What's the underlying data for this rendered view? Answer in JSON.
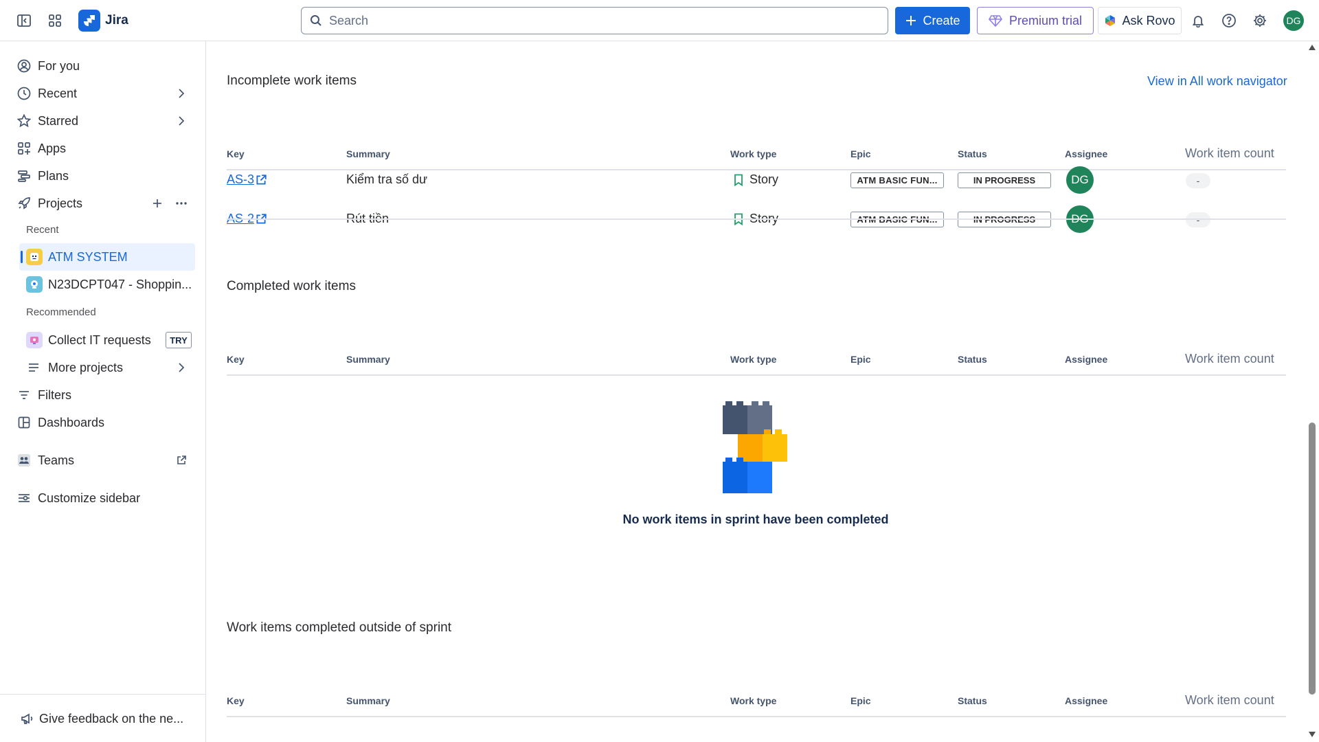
{
  "app": {
    "name": "Jira"
  },
  "search": {
    "placeholder": "Search"
  },
  "topbar": {
    "create_label": "Create",
    "premium_label": "Premium trial",
    "rovo_label": "Ask Rovo",
    "user_initials": "DG"
  },
  "sidebar": {
    "items": [
      {
        "label": "For you"
      },
      {
        "label": "Recent"
      },
      {
        "label": "Starred"
      },
      {
        "label": "Apps"
      },
      {
        "label": "Plans"
      },
      {
        "label": "Projects"
      }
    ],
    "recent_heading": "Recent",
    "recent_projects": [
      {
        "label": "ATM SYSTEM"
      },
      {
        "label": "N23DCPT047 - Shoppin..."
      }
    ],
    "recommended_heading": "Recommended",
    "recommended": [
      {
        "label": "Collect IT requests",
        "badge": "TRY"
      }
    ],
    "more_projects": "More projects",
    "filters": "Filters",
    "dashboards": "Dashboards",
    "teams": "Teams",
    "customize": "Customize sidebar",
    "feedback": "Give feedback on the ne..."
  },
  "columns": {
    "key": "Key",
    "summary": "Summary",
    "work_type": "Work type",
    "epic": "Epic",
    "status": "Status",
    "assignee": "Assignee",
    "count": "Work item count"
  },
  "incomplete": {
    "title": "Incomplete work items",
    "view_link": "View in All work navigator",
    "rows": [
      {
        "key": "AS-3",
        "summary": "Kiểm tra số dư",
        "work_type": "Story",
        "epic": "ATM BASIC FUN...",
        "status": "IN PROGRESS",
        "assignee": "DG",
        "count": "-"
      },
      {
        "key": "AS-2",
        "summary": "Rút tiền",
        "work_type": "Story",
        "epic": "ATM BASIC FUN...",
        "status": "IN PROGRESS",
        "assignee": "DG",
        "count": "-"
      }
    ]
  },
  "completed": {
    "title": "Completed work items",
    "empty_message": "No work items in sprint have been completed"
  },
  "outside": {
    "title": "Work items completed outside of sprint"
  },
  "colors": {
    "brand": "#1868db",
    "avatar": "#1f845a",
    "premium": "#5e4db2",
    "story": "#22a06b"
  }
}
